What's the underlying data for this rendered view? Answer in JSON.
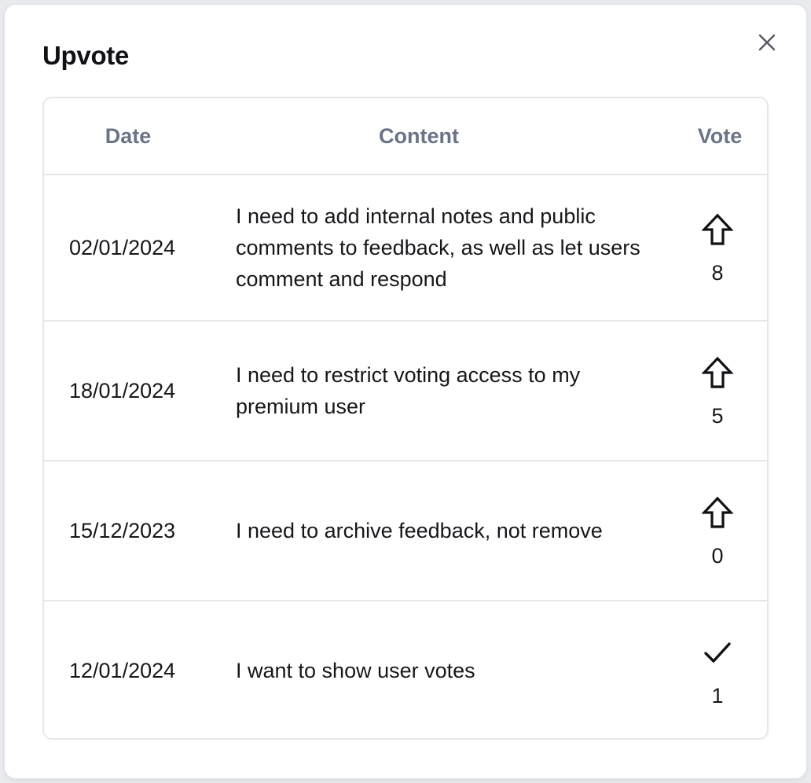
{
  "modal": {
    "title": "Upvote"
  },
  "table": {
    "headers": {
      "date": "Date",
      "content": "Content",
      "vote": "Vote"
    },
    "rows": [
      {
        "date": "02/01/2024",
        "content": "I need to add internal notes and public comments to feedback, as well as let users comment and respond",
        "vote_icon": "arrow-up-outline-icon",
        "votes": "8"
      },
      {
        "date": "18/01/2024",
        "content": "I need to restrict voting access to my premium user",
        "vote_icon": "arrow-up-outline-icon",
        "votes": "5"
      },
      {
        "date": "15/12/2023",
        "content": "I need to archive feedback, not remove",
        "vote_icon": "arrow-up-outline-icon",
        "votes": "0"
      },
      {
        "date": "12/01/2024",
        "content": "I want to show user votes",
        "vote_icon": "check-icon",
        "votes": "1"
      }
    ]
  }
}
